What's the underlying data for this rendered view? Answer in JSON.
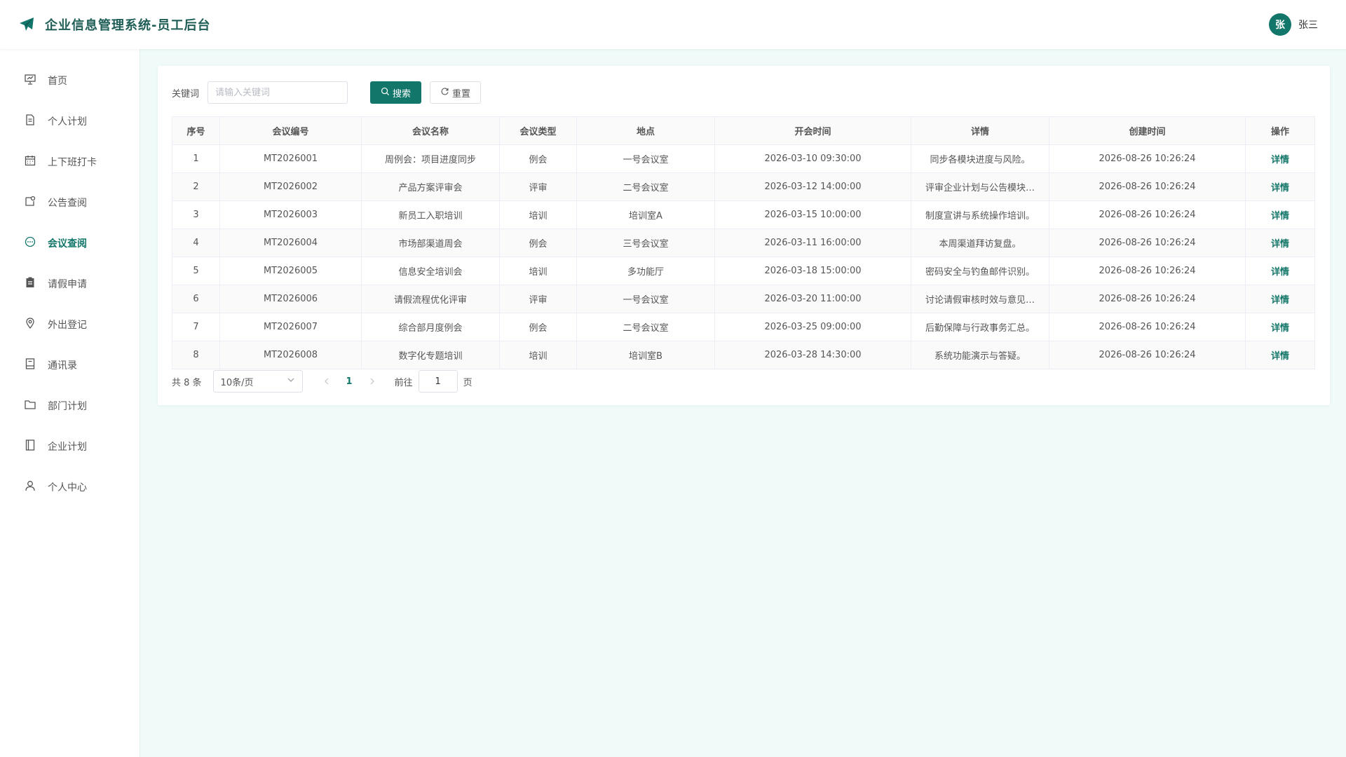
{
  "header": {
    "title": "企业信息管理系统-员工后台",
    "user_avatar": "张",
    "user_name": "张三"
  },
  "sidebar": {
    "items": [
      {
        "label": "首页",
        "icon": "presentation-icon"
      },
      {
        "label": "个人计划",
        "icon": "document-icon"
      },
      {
        "label": "上下班打卡",
        "icon": "calendar-icon"
      },
      {
        "label": "公告查阅",
        "icon": "notice-icon"
      },
      {
        "label": "会议查阅",
        "icon": "chat-icon",
        "active": true
      },
      {
        "label": "请假申请",
        "icon": "clipboard-icon"
      },
      {
        "label": "外出登记",
        "icon": "location-icon"
      },
      {
        "label": "通讯录",
        "icon": "contact-book-icon"
      },
      {
        "label": "部门计划",
        "icon": "folder-icon"
      },
      {
        "label": "企业计划",
        "icon": "notebook-icon"
      },
      {
        "label": "个人中心",
        "icon": "user-icon"
      }
    ]
  },
  "search": {
    "label": "关键词",
    "placeholder": "请输入关键词",
    "value": "",
    "search_button": "搜索",
    "reset_button": "重置"
  },
  "table": {
    "columns": [
      "序号",
      "会议编号",
      "会议名称",
      "会议类型",
      "地点",
      "开会时间",
      "详情",
      "创建时间",
      "操作"
    ],
    "rows": [
      [
        "1",
        "MT2026001",
        "周例会：项目进度同步",
        "例会",
        "一号会议室",
        "2026-03-10 09:30:00",
        "同步各模块进度与风险。",
        "2026-08-26 10:26:24",
        "详情"
      ],
      [
        "2",
        "MT2026002",
        "产品方案评审会",
        "评审",
        "二号会议室",
        "2026-03-12 14:00:00",
        "评审企业计划与公告模块…",
        "2026-08-26 10:26:24",
        "详情"
      ],
      [
        "3",
        "MT2026003",
        "新员工入职培训",
        "培训",
        "培训室A",
        "2026-03-15 10:00:00",
        "制度宣讲与系统操作培训。",
        "2026-08-26 10:26:24",
        "详情"
      ],
      [
        "4",
        "MT2026004",
        "市场部渠道周会",
        "例会",
        "三号会议室",
        "2026-03-11 16:00:00",
        "本周渠道拜访复盘。",
        "2026-08-26 10:26:24",
        "详情"
      ],
      [
        "5",
        "MT2026005",
        "信息安全培训会",
        "培训",
        "多功能厅",
        "2026-03-18 15:00:00",
        "密码安全与钓鱼邮件识别。",
        "2026-08-26 10:26:24",
        "详情"
      ],
      [
        "6",
        "MT2026006",
        "请假流程优化评审",
        "评审",
        "一号会议室",
        "2026-03-20 11:00:00",
        "讨论请假审核时效与意见…",
        "2026-08-26 10:26:24",
        "详情"
      ],
      [
        "7",
        "MT2026007",
        "综合部月度例会",
        "例会",
        "二号会议室",
        "2026-03-25 09:00:00",
        "后勤保障与行政事务汇总。",
        "2026-08-26 10:26:24",
        "详情"
      ],
      [
        "8",
        "MT2026008",
        "数字化专题培训",
        "培训",
        "培训室B",
        "2026-03-28 14:30:00",
        "系统功能演示与答疑。",
        "2026-08-26 10:26:24",
        "详情"
      ]
    ]
  },
  "pager": {
    "total": "共 8 条",
    "page_size": "10条/页",
    "current_page": "1",
    "goto_prefix": "前往",
    "goto_value": "1",
    "goto_suffix": "页"
  },
  "colors": {
    "accent": "#13766a",
    "background": "#f0fbf9"
  }
}
